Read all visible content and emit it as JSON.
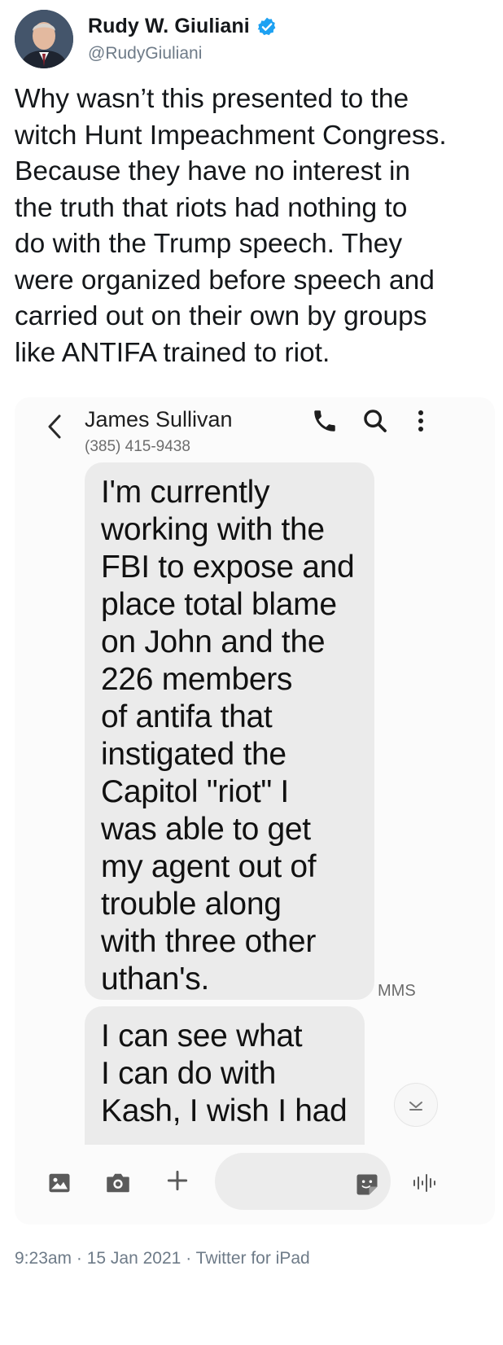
{
  "tweet": {
    "author_name": "Rudy W. Giuliani",
    "author_handle": "@RudyGiuliani",
    "text_lines": [
      "Why wasn’t this presented to the",
      "witch Hunt Impeachment Congress.",
      "Because they have no interest in",
      "the truth that riots had nothing to",
      "do with the Trump speech. They",
      "were organized before speech and",
      "carried out on their own by groups",
      "like ANTIFA trained to riot."
    ],
    "footer": {
      "time": "9:23am",
      "date": "15 Jan 2021",
      "source": "Twitter for iPad",
      "separator": "·"
    }
  },
  "sms": {
    "contact_name": "James Sullivan",
    "contact_phone": "(385) 415-9438",
    "messages": [
      {
        "lines": [
          "I'm currently",
          "working with the",
          "FBI to expose and",
          "place total blame",
          "on John and the",
          "226 members",
          "of antifa that",
          "instigated the",
          "Capitol \"riot\" I",
          "was able to get",
          "my agent out of",
          "trouble along",
          "with three other",
          "uthan's."
        ],
        "type_label": "MMS"
      },
      {
        "lines": [
          "I can see what",
          "I can do with",
          "Kash, I wish I had"
        ]
      }
    ],
    "input_placeholder": ""
  },
  "colors": {
    "verified_badge": "#1da1f2",
    "bubble": "#ebebeb",
    "card_background": "#fbfbfb",
    "secondary_text": "#6e7b88"
  },
  "icons": {
    "header": [
      "back-icon",
      "phone-call-icon",
      "search-icon",
      "more-vertical-icon"
    ],
    "toolbar": [
      "gallery-icon",
      "camera-icon",
      "plus-icon",
      "sticker-icon",
      "voice-icon"
    ],
    "scroll": "chevron-down-icon",
    "badge": "verified-icon"
  }
}
